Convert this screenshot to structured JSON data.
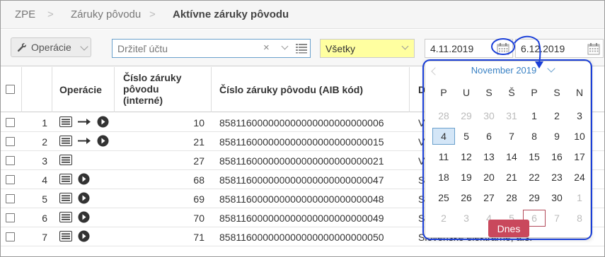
{
  "breadcrumb": {
    "items": [
      "ZPE",
      "Záruky pôvodu",
      "Aktívne záruky pôvodu"
    ],
    "separator": ">"
  },
  "toolbar": {
    "operations_label": "Operácie",
    "holder_placeholder": "Držiteľ účtu",
    "clear_symbol": "×",
    "status_value": "Všetky",
    "date_from": "4.11.2019",
    "date_to": "6.12.2019"
  },
  "table": {
    "headers": {
      "operations": "Operácie",
      "internal_id": "Číslo záruky pôvodu (interné)",
      "aib_code": "Číslo záruky pôvodu (AIB kód)",
      "owner": "D"
    },
    "rows": [
      {
        "n": "1",
        "ops": "doc-arrow-play",
        "id": "10",
        "aib": "858116000000000000000000000006",
        "owner": "V"
      },
      {
        "n": "2",
        "ops": "doc-arrow-play",
        "id": "21",
        "aib": "858116000000000000000000000015",
        "owner": "V"
      },
      {
        "n": "3",
        "ops": "doc",
        "id": "27",
        "aib": "858116000000000000000000000021",
        "owner": "V"
      },
      {
        "n": "4",
        "ops": "doc-play",
        "id": "68",
        "aib": "858116000000000000000000000047",
        "owner": "S"
      },
      {
        "n": "5",
        "ops": "doc-play",
        "id": "69",
        "aib": "858116000000000000000000000048",
        "owner": "S"
      },
      {
        "n": "6",
        "ops": "doc-play",
        "id": "70",
        "aib": "858116000000000000000000000049",
        "owner": "S"
      },
      {
        "n": "7",
        "ops": "doc-play",
        "id": "71",
        "aib": "858116000000000000000000000050",
        "owner": "Slovenské elektrárne, a.s."
      }
    ]
  },
  "calendar": {
    "title": "November 2019",
    "weekdays": [
      "P",
      "U",
      "S",
      "Š",
      "P",
      "S",
      "N"
    ],
    "weeks": [
      [
        "28",
        "29",
        "30",
        "31",
        "1",
        "2",
        "3"
      ],
      [
        "4",
        "5",
        "6",
        "7",
        "8",
        "9",
        "10"
      ],
      [
        "11",
        "12",
        "13",
        "14",
        "15",
        "16",
        "17"
      ],
      [
        "18",
        "19",
        "20",
        "21",
        "22",
        "23",
        "24"
      ],
      [
        "25",
        "26",
        "27",
        "28",
        "29",
        "30",
        "1"
      ],
      [
        "2",
        "3",
        "4",
        "5",
        "6",
        "7",
        "8"
      ]
    ],
    "muted_first_week_count": 4,
    "muted_last_week_from": 6,
    "muted_sixth_week": true,
    "selected": "4",
    "today": "6",
    "today_button": "Dnes"
  },
  "colors": {
    "accent": "#3a82c4",
    "annotation": "#1a3fd8",
    "today_button": "#c9485c",
    "status_bg": "#ffffa0"
  },
  "icons": [
    "wrench-icon",
    "list-icon",
    "calendar-icon",
    "document-icon",
    "arrow-right-icon",
    "play-circle-icon",
    "chevron-down-icon",
    "chevron-left-icon"
  ]
}
